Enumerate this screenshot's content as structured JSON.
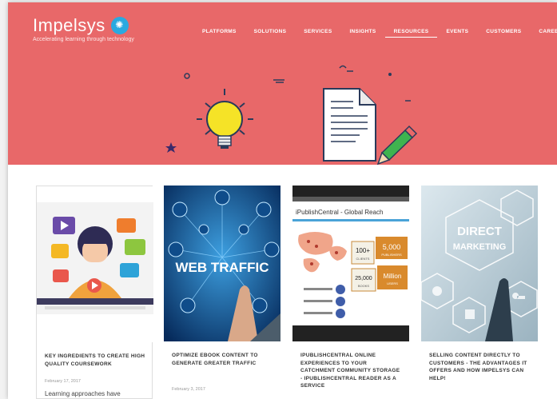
{
  "brand": {
    "name": "Impelsys",
    "tagline": "Accelerating learning through technology",
    "logo_color": "#2aa9e0"
  },
  "nav": {
    "items": [
      {
        "label": "PLATFORMS",
        "active": false
      },
      {
        "label": "SOLUTIONS",
        "active": false
      },
      {
        "label": "SERVICES",
        "active": false
      },
      {
        "label": "INSIGHTS",
        "active": false
      },
      {
        "label": "RESOURCES",
        "active": true
      },
      {
        "label": "EVENTS",
        "active": false
      },
      {
        "label": "CUSTOMERS",
        "active": false
      },
      {
        "label": "CAREERS",
        "active": false
      }
    ]
  },
  "hero": {
    "background": "#e86869",
    "illustration_icons": [
      "lightbulb-icon",
      "document-icon",
      "pencil-icon",
      "star-icon"
    ]
  },
  "cards": [
    {
      "title": "KEY INGREDIENTS TO CREATE HIGH QUALITY COURSEWORK",
      "date": "February 17, 2017",
      "excerpt": "Learning approaches have",
      "thumb_icons": [
        "play-icon",
        "headset-icon",
        "chat-bubble-icon"
      ]
    },
    {
      "title": "OPTIMIZE EBOOK CONTENT TO GENERATE GREATER TRAFFIC",
      "date": "February 3, 2017",
      "excerpt": "",
      "thumb_text": "WEB TRAFFIC",
      "thumb_icons": [
        "network-icon",
        "touch-icon"
      ]
    },
    {
      "title": "IPUBLISHCENTRAL ONLINE EXPERIENCES TO YOUR CATCHMENT COMMUNITY STORAGE - IPUBLISHCENTRAL READER AS A SERVICE",
      "date": "",
      "excerpt": "",
      "thumb_text": "iPublishCentral - Global Reach",
      "thumb_stats": [
        {
          "value": "100+",
          "label": "CLIENTS"
        },
        {
          "value": "5,000",
          "label": "PUBLISHERS"
        },
        {
          "value": "25,000",
          "label": "BOOKS"
        },
        {
          "value": "Million",
          "label": "USERS"
        }
      ],
      "thumb_icons": [
        "world-map-icon"
      ]
    },
    {
      "title": "SELLING CONTENT DIRECTLY TO CUSTOMERS - THE ADVANTAGES IT OFFERS AND HOW IMPELSYS CAN HELP!",
      "date": "",
      "excerpt": "",
      "thumb_text": "DIRECT MARKETING",
      "thumb_icons": [
        "hexagon-icon",
        "puzzle-icon",
        "gear-icon",
        "key-icon"
      ]
    }
  ]
}
